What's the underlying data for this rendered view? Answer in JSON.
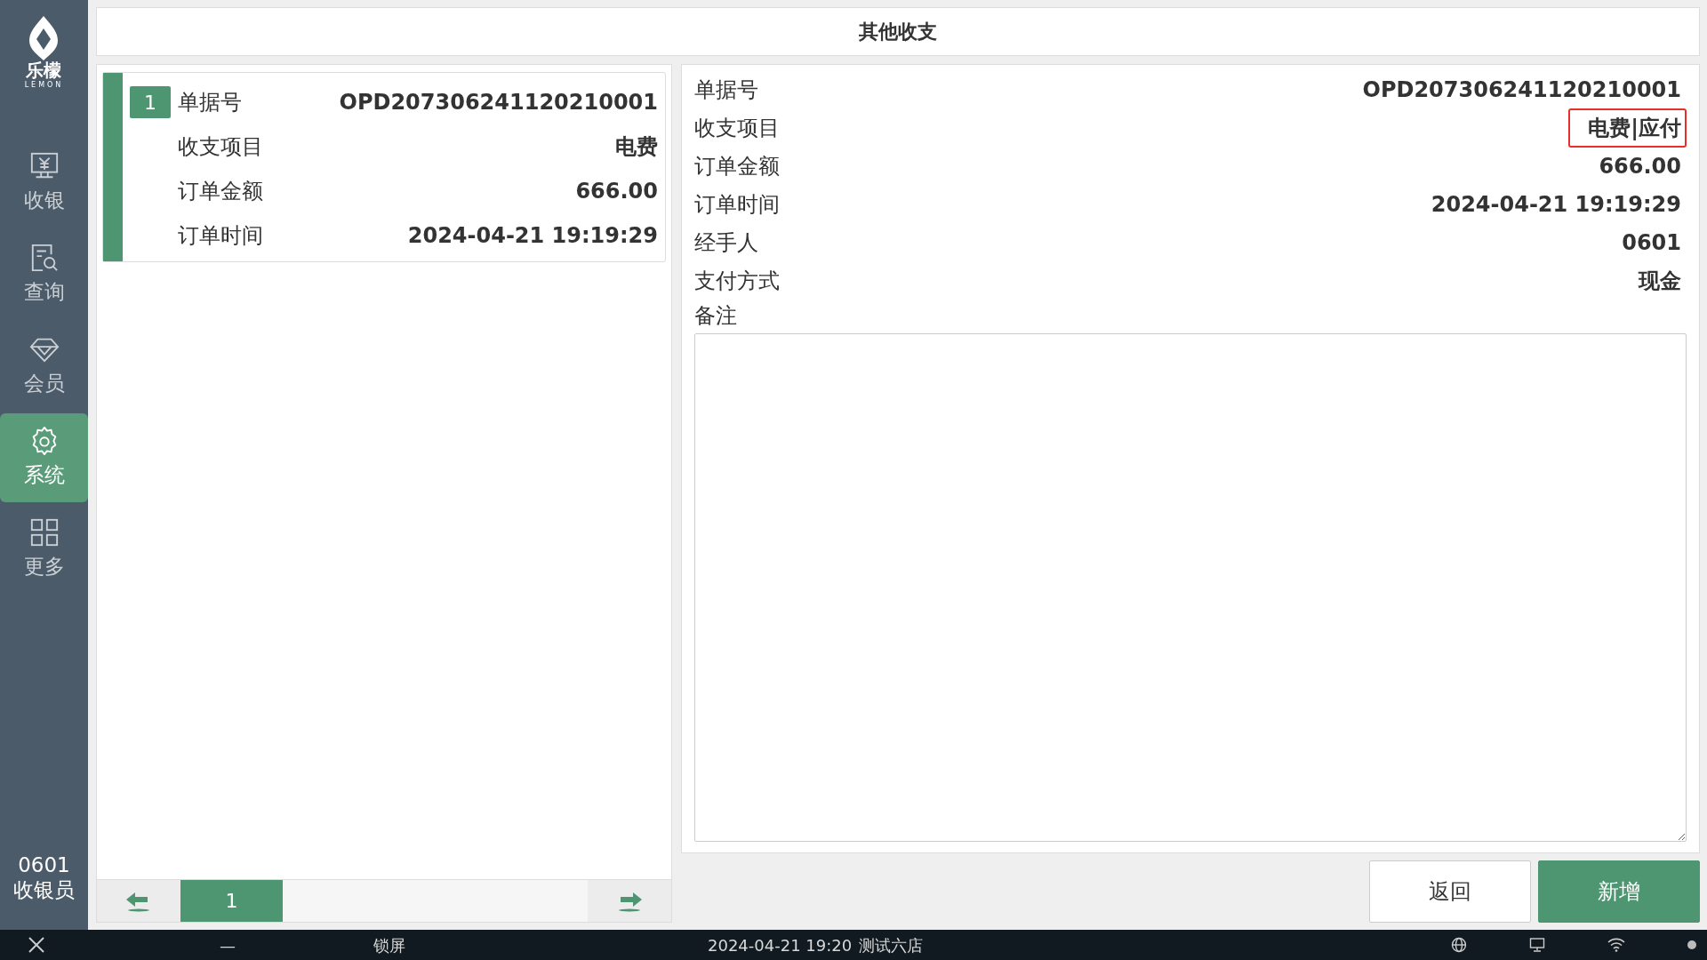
{
  "sidebar": {
    "logo": {
      "name": "乐檬",
      "sub": "LEMON"
    },
    "items": [
      {
        "label": "收银",
        "selected": false
      },
      {
        "label": "查询",
        "selected": false
      },
      {
        "label": "会员",
        "selected": false
      },
      {
        "label": "系统",
        "selected": true
      },
      {
        "label": "更多",
        "selected": false
      }
    ],
    "user": {
      "id": "0601",
      "role": "收银员"
    }
  },
  "header": {
    "title": "其他收支"
  },
  "list": {
    "records": [
      {
        "index": "1",
        "selected": true,
        "fields": [
          {
            "label": "单据号",
            "value": "OPD207306241120210001"
          },
          {
            "label": "收支项目",
            "value": "电费"
          },
          {
            "label": "订单金额",
            "value": "666.00"
          },
          {
            "label": "订单时间",
            "value": "2024-04-21 19:19:29"
          }
        ]
      }
    ],
    "pager": {
      "pages": [
        {
          "label": "1",
          "selected": true
        }
      ]
    }
  },
  "detail": {
    "fields": [
      {
        "label": "单据号",
        "value": "OPD207306241120210001",
        "highlighted": false
      },
      {
        "label": "收支项目",
        "value": "电费|应付",
        "highlighted": true
      },
      {
        "label": "订单金额",
        "value": "666.00",
        "highlighted": false
      },
      {
        "label": "订单时间",
        "value": "2024-04-21 19:19:29",
        "highlighted": false
      },
      {
        "label": "经手人",
        "value": "0601",
        "highlighted": false
      },
      {
        "label": "支付方式",
        "value": "现金",
        "highlighted": false
      }
    ],
    "remark_label": "备注"
  },
  "buttons": [
    {
      "label": "返回",
      "kind": "secondary"
    },
    {
      "label": "新增",
      "kind": "primary"
    }
  ],
  "taskbar": {
    "minimize": "—",
    "lock": "锁屏",
    "datetime": "2024-04-21 19:20",
    "store": "测试六店"
  }
}
